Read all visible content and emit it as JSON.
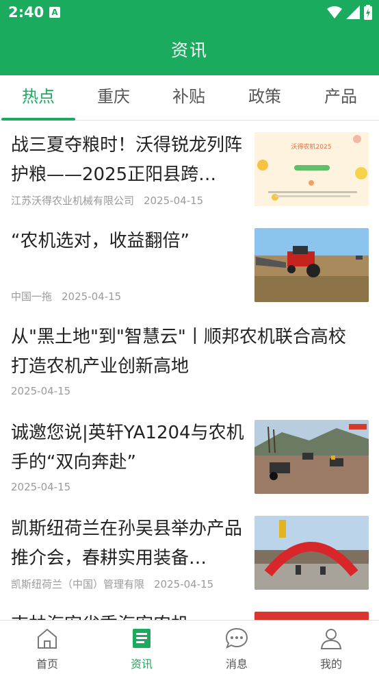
{
  "status": {
    "time": "2:40",
    "notif_icon": "A"
  },
  "header": {
    "title": "资讯"
  },
  "tabs": [
    {
      "label": "热点",
      "active": true
    },
    {
      "label": "重庆"
    },
    {
      "label": "补贴"
    },
    {
      "label": "政策"
    },
    {
      "label": "产品"
    }
  ],
  "news": [
    {
      "title": "战三夏夺粮时！沃得锐龙列阵护粮——2025正阳县跨…",
      "source": "江苏沃得农业机械有限公司",
      "date": "2025-04-15",
      "thumb": "poster",
      "thumb_text": "沃得农机2025"
    },
    {
      "title": "“农机选对，收益翻倍”",
      "source": "中国一拖",
      "date": "2025-04-15",
      "thumb": "tractor-field"
    },
    {
      "title": "从\"黑土地\"到\"智慧云\"丨顺邦农机联合高校打造农机产业创新高地",
      "source": "",
      "date": "2025-04-15",
      "thumb": ""
    },
    {
      "title": "诚邀您说|英轩YA1204与农机手的“双向奔赴”",
      "source": "",
      "date": "2025-04-15",
      "thumb": "tractors-hill"
    },
    {
      "title": "凯斯纽荷兰在孙吴县举办产品推介会，春耕实用装备…",
      "source": "凯斯纽荷兰（中国）管理有限",
      "date": "2025-04-15",
      "thumb": "red-arch"
    },
    {
      "title": "吉林海宏省季海宏农机…",
      "source": "",
      "date": "",
      "thumb": "red"
    }
  ],
  "bottom_nav": [
    {
      "label": "首页",
      "icon": "home-icon"
    },
    {
      "label": "资讯",
      "icon": "news-icon",
      "active": true
    },
    {
      "label": "消息",
      "icon": "message-icon"
    },
    {
      "label": "我的",
      "icon": "user-icon"
    }
  ],
  "colors": {
    "brand": "#1aab5e",
    "text": "#222222",
    "meta": "#9a9a9a"
  }
}
